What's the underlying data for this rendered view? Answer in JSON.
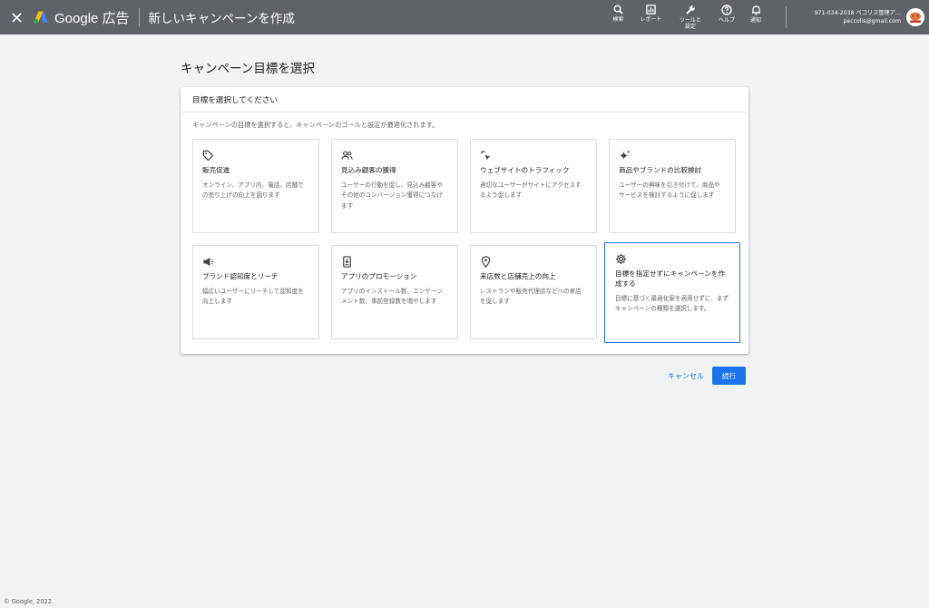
{
  "header": {
    "brand": "Google 広告",
    "page_title": "新しいキャンペーンを作成",
    "tools": [
      {
        "icon": "search-icon",
        "label": "検索"
      },
      {
        "icon": "report-icon",
        "label": "レポート"
      },
      {
        "icon": "wrench-icon",
        "label": "ツールと\n設定"
      },
      {
        "icon": "help-icon",
        "label": "ヘルプ"
      },
      {
        "icon": "bell-icon",
        "label": "通知"
      }
    ],
    "account_name": "971-034-2038 ペコリス管理ア…",
    "account_email": "peccolis@gmail.com"
  },
  "main": {
    "heading": "キャンペーン目標を選択",
    "card_header": "目標を選択してください",
    "card_description": "キャンペーンの目標を選択すると、キャンペーンのゴールと設定が最適化されます。",
    "goals": [
      {
        "icon": "tag-icon",
        "title": "販売促進",
        "description": "オンライン、アプリ内、電話、店舗での売り上げの向上を図ります",
        "selected": false
      },
      {
        "icon": "people-icon",
        "title": "見込み顧客の獲得",
        "description": "ユーザーの行動を促し、見込み顧客やその他のコンバージョン獲得につなげます",
        "selected": false
      },
      {
        "icon": "cursor-click-icon",
        "title": "ウェブサイトのトラフィック",
        "description": "適切なユーザーがサイトにアクセスするよう促します",
        "selected": false
      },
      {
        "icon": "sparkle-icon",
        "title": "商品やブランドの比較検討",
        "description": "ユーザーの興味を引き付けて、商品やサービスを検討するように促します",
        "selected": false
      },
      {
        "icon": "megaphone-icon",
        "title": "ブランド認知度とリーチ",
        "description": "幅広いユーザーにリーチして認知度を向上します",
        "selected": false
      },
      {
        "icon": "phone-download-icon",
        "title": "アプリのプロモーション",
        "description": "アプリのインストール数、エンゲージメント数、事前登録数を増やします",
        "selected": false
      },
      {
        "icon": "location-pin-icon",
        "title": "来店数と店舗売上の向上",
        "description": "レストランや販売代理店などへの来店を促します",
        "selected": false
      },
      {
        "icon": "gear-icon",
        "title": "目標を指定せずにキャンペーンを作成する",
        "description": "目標に基づく最適化案を適用せずに、まずキャンペーンの種類を選択します。",
        "selected": true
      }
    ],
    "cancel_label": "キャンセル",
    "continue_label": "続行"
  },
  "footer": {
    "copyright": "© Google, 2022."
  },
  "colors": {
    "header_bg": "#5f6368",
    "page_bg": "#f1f3f4",
    "accent": "#1a73e8",
    "selected_border": "#1a73e8"
  }
}
